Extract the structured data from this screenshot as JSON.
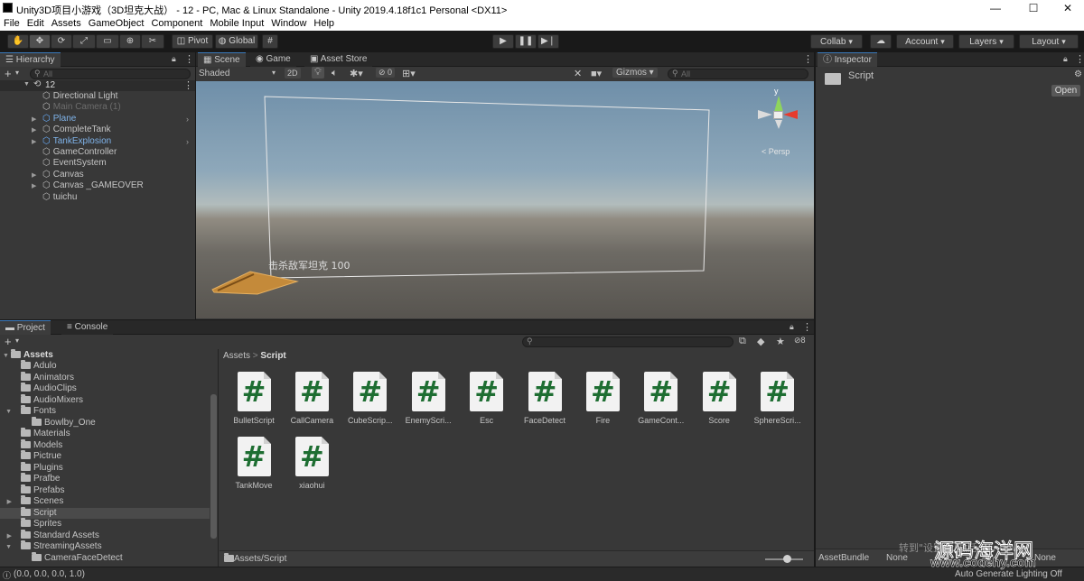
{
  "titlebar": {
    "title": "Unity3D项目小游戏（3D坦克大战） - 12 - PC, Mac & Linux Standalone - Unity 2019.4.18f1c1 Personal <DX11>",
    "minimize": "—",
    "maximize": "☐",
    "close": "✕"
  },
  "menu": [
    "File",
    "Edit",
    "Assets",
    "GameObject",
    "Component",
    "Mobile Input",
    "Window",
    "Help"
  ],
  "toolbar": {
    "pivot": "Pivot",
    "global": "Global",
    "collab": "Collab",
    "account": "Account",
    "layers": "Layers",
    "layout": "Layout"
  },
  "hierarchy": {
    "tab": "Hierarchy",
    "add": "+",
    "search_placeholder": "All",
    "scene": "12",
    "items": [
      {
        "name": "Directional Light",
        "style": "normal",
        "expand": false
      },
      {
        "name": "Main Camera (1)",
        "style": "dim",
        "expand": false
      },
      {
        "name": "Plane",
        "style": "blue",
        "expand": true
      },
      {
        "name": "CompleteTank",
        "style": "normal",
        "expand": true
      },
      {
        "name": "TankExplosion",
        "style": "blue",
        "expand": true
      },
      {
        "name": "GameController",
        "style": "normal",
        "expand": false
      },
      {
        "name": "EventSystem",
        "style": "normal",
        "expand": false
      },
      {
        "name": "Canvas",
        "style": "normal",
        "expand": true
      },
      {
        "name": "Canvas _GAMEOVER",
        "style": "normal",
        "expand": true
      },
      {
        "name": "tuichu",
        "style": "normal",
        "expand": false
      }
    ]
  },
  "scene": {
    "tabs": [
      "Scene",
      "Game",
      "Asset Store"
    ],
    "shading": "Shaded",
    "mode2d": "2D",
    "fx_count": "0",
    "gizmos": "Gizmos",
    "search_placeholder": "All",
    "persp": "< Persp",
    "ui_text": "击杀敌军坦克  100",
    "axis_y": "y",
    "axis_x": "x"
  },
  "project": {
    "tabs": [
      "Project",
      "Console"
    ],
    "add": "+",
    "search_placeholder": "",
    "hidden_count": "8",
    "root": "Assets",
    "folders": [
      {
        "name": "Adulo",
        "depth": 1,
        "open": false,
        "has_children": false
      },
      {
        "name": "Animators",
        "depth": 1,
        "open": false,
        "has_children": false
      },
      {
        "name": "AudioClips",
        "depth": 1,
        "open": false,
        "has_children": false
      },
      {
        "name": "AudioMixers",
        "depth": 1,
        "open": false,
        "has_children": false
      },
      {
        "name": "Fonts",
        "depth": 1,
        "open": true,
        "has_children": true
      },
      {
        "name": "Bowlby_One",
        "depth": 2,
        "open": false,
        "has_children": false
      },
      {
        "name": "Materials",
        "depth": 1,
        "open": false,
        "has_children": false
      },
      {
        "name": "Models",
        "depth": 1,
        "open": false,
        "has_children": false
      },
      {
        "name": "Pictrue",
        "depth": 1,
        "open": false,
        "has_children": false
      },
      {
        "name": "Plugins",
        "depth": 1,
        "open": false,
        "has_children": false
      },
      {
        "name": "Prafbe",
        "depth": 1,
        "open": false,
        "has_children": false
      },
      {
        "name": "Prefabs",
        "depth": 1,
        "open": false,
        "has_children": false
      },
      {
        "name": "Scenes",
        "depth": 1,
        "open": false,
        "has_children": true
      },
      {
        "name": "Script",
        "depth": 1,
        "open": false,
        "has_children": false,
        "selected": true
      },
      {
        "name": "Sprites",
        "depth": 1,
        "open": false,
        "has_children": false
      },
      {
        "name": "Standard Assets",
        "depth": 1,
        "open": false,
        "has_children": true
      },
      {
        "name": "StreamingAssets",
        "depth": 1,
        "open": true,
        "has_children": true
      },
      {
        "name": "CameraFaceDetect",
        "depth": 2,
        "open": false,
        "has_children": false
      }
    ],
    "breadcrumb": [
      "Assets",
      "Script"
    ],
    "assets": [
      "BulletScript",
      "CallCamera",
      "CubeScrip...",
      "EnemyScri...",
      "Esc",
      "FaceDetect",
      "Fire",
      "GameCont...",
      "Score",
      "SphereScri...",
      "TankMove",
      "xiaohui"
    ],
    "asset_glyph": "#",
    "footer_path": "Assets/Script"
  },
  "inspector": {
    "tab": "Inspector",
    "object_name": "Script",
    "open_button": "Open",
    "assetbundle_label": "AssetBundle",
    "assetbundle_value": "None",
    "assetbundle_variant": "None"
  },
  "statusbar": {
    "text": "(0.0, 0.0, 0.0, 1.0)",
    "lighting": "Auto Generate Lighting Off"
  },
  "watermark": {
    "line1": "源码海洋网",
    "line2": "www.codehy.com",
    "faint": "转到\"设置\"以激活 Windows。"
  },
  "colors": {
    "accent_blue": "#3a79bb",
    "prefab_blue": "#7fb3ea",
    "script_green": "#1e6e32"
  }
}
